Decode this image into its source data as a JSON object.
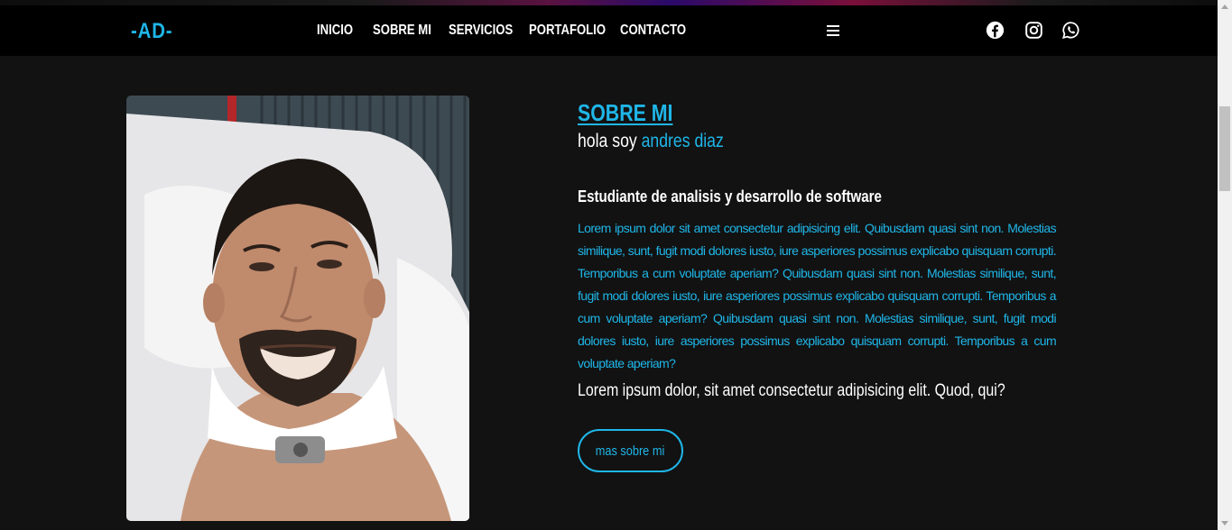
{
  "brand": {
    "logo": "-AD-",
    "accent": "#1fb6e8"
  },
  "nav": {
    "links": [
      "INICIO",
      "SOBRE MI",
      "SERVICIOS",
      "PORTAFOLIO",
      "CONTACTO"
    ]
  },
  "social": {
    "icons": [
      "facebook-icon",
      "instagram-icon",
      "whatsapp-icon"
    ]
  },
  "about": {
    "title": "SOBRE MI",
    "greeting_prefix": "hola soy",
    "name": "andres diaz",
    "subtitle": "Estudiante de analisis y desarrollo de software",
    "paragraph": "Lorem ipsum dolor sit amet consectetur adipisicing elit. Quibusdam quasi sint non. Molestias similique, sunt, fugit modi dolores iusto, iure asperiores possimus explicabo quisquam corrupti. Temporibus a cum voluptate aperiam? Quibusdam quasi sint non. Molestias similique, sunt, fugit modi dolores iusto, iure asperiores possimus explicabo quisquam corrupti. Temporibus a cum voluptate aperiam? Quibusdam quasi sint non. Molestias similique, sunt, fugit modi dolores iusto, iure asperiores possimus explicabo quisquam corrupti. Temporibus a cum voluptate aperiam?",
    "lead": "Lorem ipsum dolor, sit amet consectetur adipisicing elit. Quod, qui?",
    "button_label": "mas sobre mi"
  }
}
